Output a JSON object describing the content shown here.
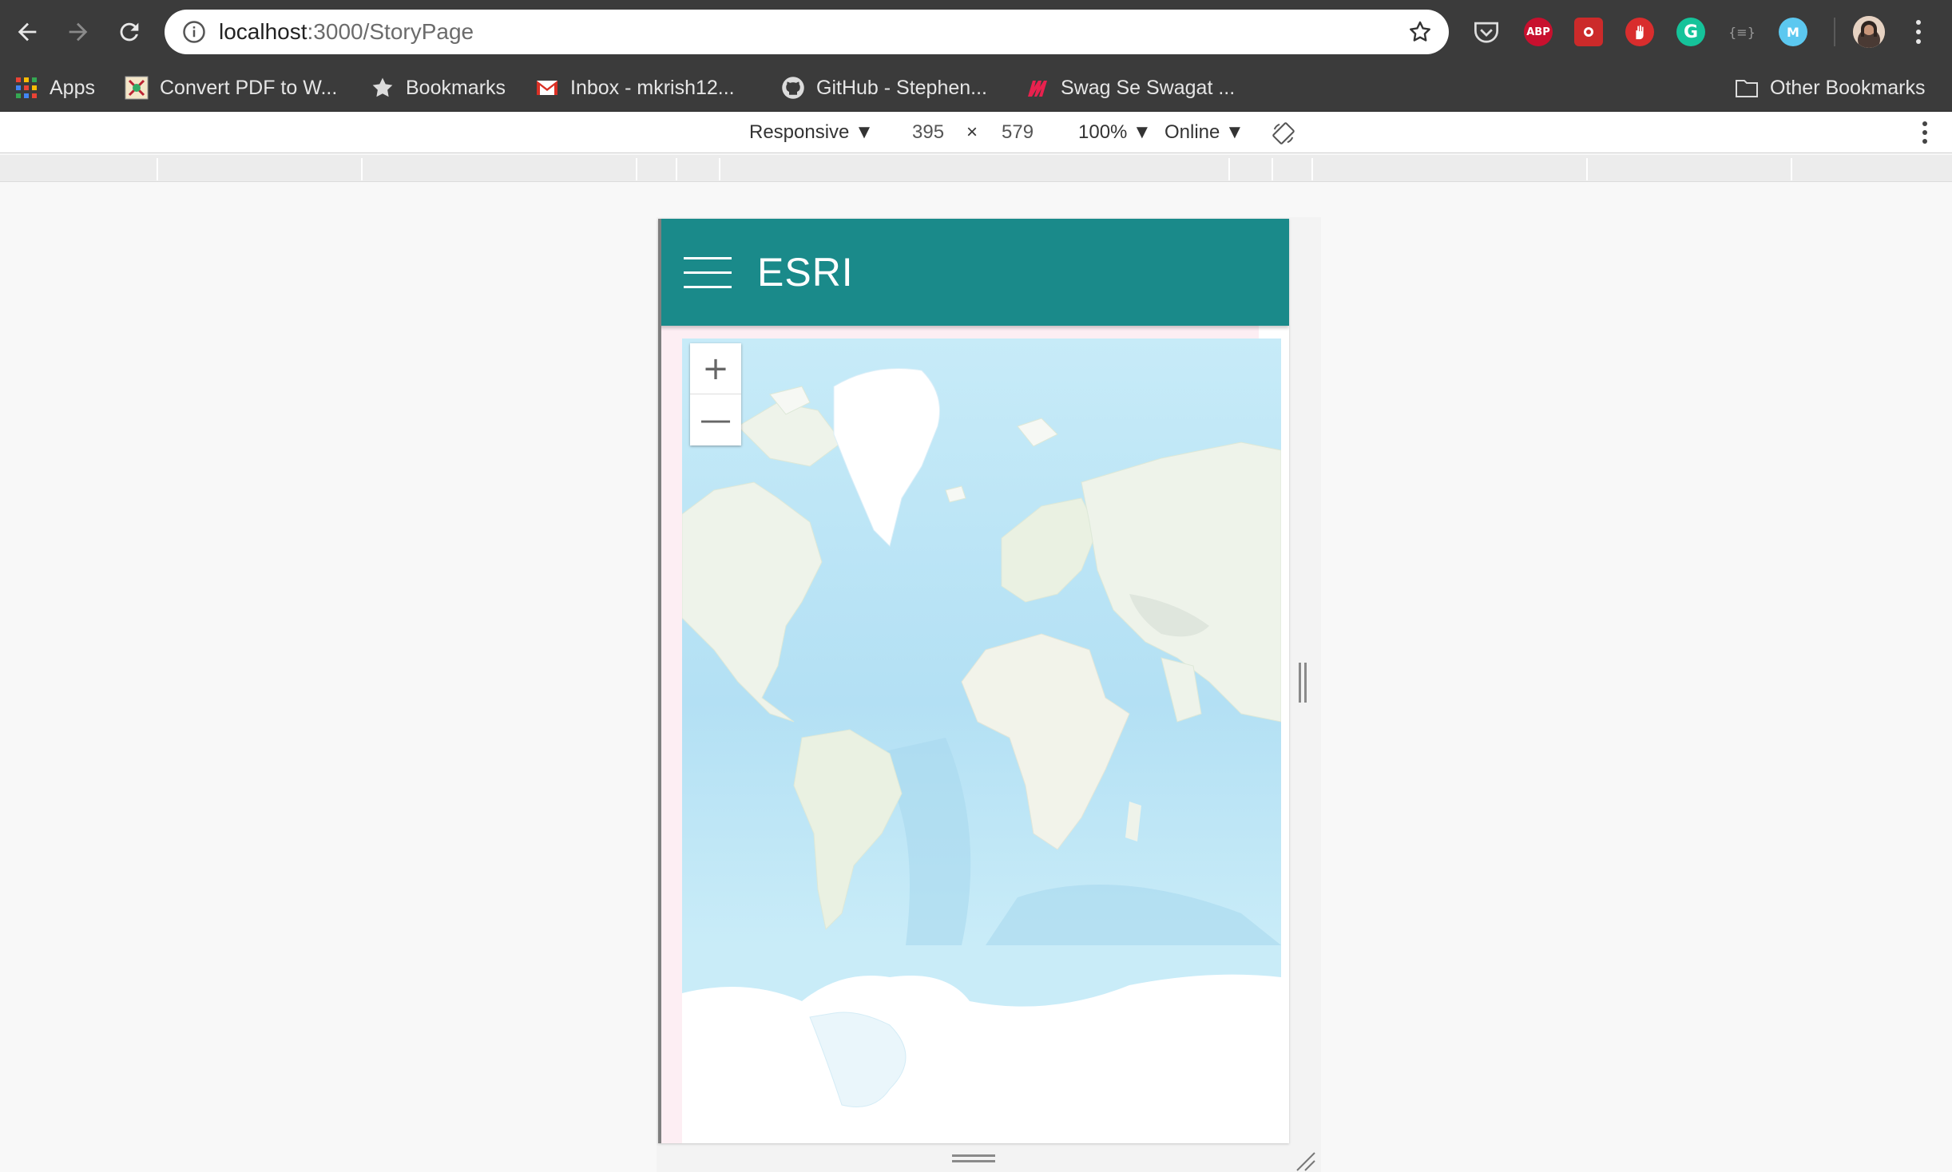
{
  "browser": {
    "url_host": "localhost",
    "url_path": ":3000/StoryPage",
    "extensions": [
      {
        "name": "pocket-icon",
        "color": "#3b3b3b"
      },
      {
        "name": "abp-icon",
        "label": "ABP",
        "color": "#c8102e"
      },
      {
        "name": "extension-red-icon",
        "color": "#d33"
      },
      {
        "name": "stop-hand-icon",
        "color": "#d92d2d"
      },
      {
        "name": "grammarly-icon",
        "label": "G",
        "color": "#15c39a"
      },
      {
        "name": "json-formatter-icon",
        "label": "{≡}",
        "color": "#3b3b3b"
      },
      {
        "name": "extension-m-icon",
        "label": "M",
        "color": "#5cc8f0"
      }
    ]
  },
  "bookmarks": {
    "apps": "Apps",
    "items": [
      "Convert PDF to W...",
      "Bookmarks",
      "Inbox - mkrish12...",
      "GitHub - Stephen...",
      "Swag Se Swagat ..."
    ],
    "other": "Other Bookmarks"
  },
  "devtools": {
    "device_mode": "Responsive ▼",
    "width": "395",
    "times": "×",
    "height": "579",
    "zoom": "100% ▼",
    "network": "Online ▼"
  },
  "app": {
    "title": "ESRI",
    "zoom_in": "+",
    "zoom_out": "—"
  },
  "colors": {
    "header": "#1a8a8a",
    "ocean": "#b9e3f5",
    "land": "#eef3ea",
    "ice": "#ffffff"
  }
}
